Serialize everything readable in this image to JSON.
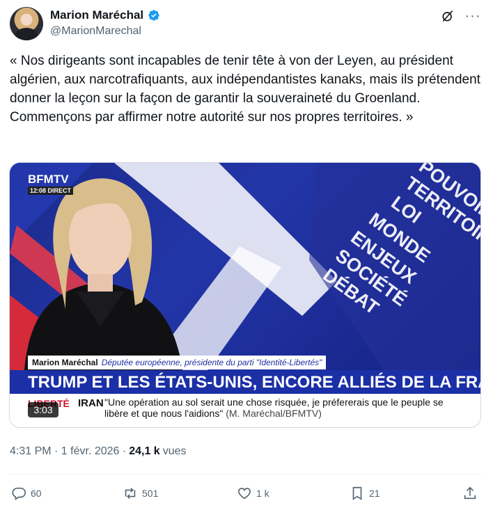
{
  "author": {
    "display_name": "Marion Maréchal",
    "handle": "@MarionMarechal"
  },
  "icons": {
    "verified": "verified-badge-icon",
    "grok": "grok-icon",
    "more": "more-icon"
  },
  "tweet": {
    "text": "« Nos dirigeants sont incapables de tenir tête à von der Leyen, au président algérien, aux narcotrafiquants, aux indépendantistes kanaks, mais ils prétendent donner la leçon sur la façon de garantir la souveraineté du Groenland.\nCommençons par affirmer notre autorité sur nos propres territoires. »"
  },
  "video": {
    "channel_logo": "BFMTV",
    "time_badge": "12:08 DIRECT",
    "bg_words": [
      "POUVOIR",
      "TERRITOIRE",
      "LOI",
      "MONDE",
      "ENJEUX",
      "SOCIÉTÉ",
      "DÉBAT"
    ],
    "lower_third_name": "Marion Maréchal",
    "lower_third_role": "Députée européenne, présidente du parti \"Identité-Libertés\"",
    "headline": "TRUMP ET LES ÉTATS-UNIS, ENCORE ALLIÉS DE LA FRANCE ?",
    "ticker_label": "LIBERTÉ",
    "ticker_topic": "IRAN",
    "ticker_text": "\"Une opération au sol serait une chose risquée, je préfererais que le peuple se libère et que nous l'aidions\"",
    "ticker_source": "(M. Maréchal/BFMTV)",
    "duration": "3:03"
  },
  "meta": {
    "timestamp": "4:31 PM · 1 févr. 2026 ·",
    "views_count": "24,1 k",
    "views_label": "vues"
  },
  "actions": {
    "replies": "60",
    "reposts": "501",
    "likes": "1 k",
    "bookmarks": "21"
  },
  "colors": {
    "text": "#0f1419",
    "secondary": "#536471",
    "verified": "#1d9bf0",
    "bfm_blue": "#1b2fa6",
    "bfm_red": "#c8102e"
  }
}
